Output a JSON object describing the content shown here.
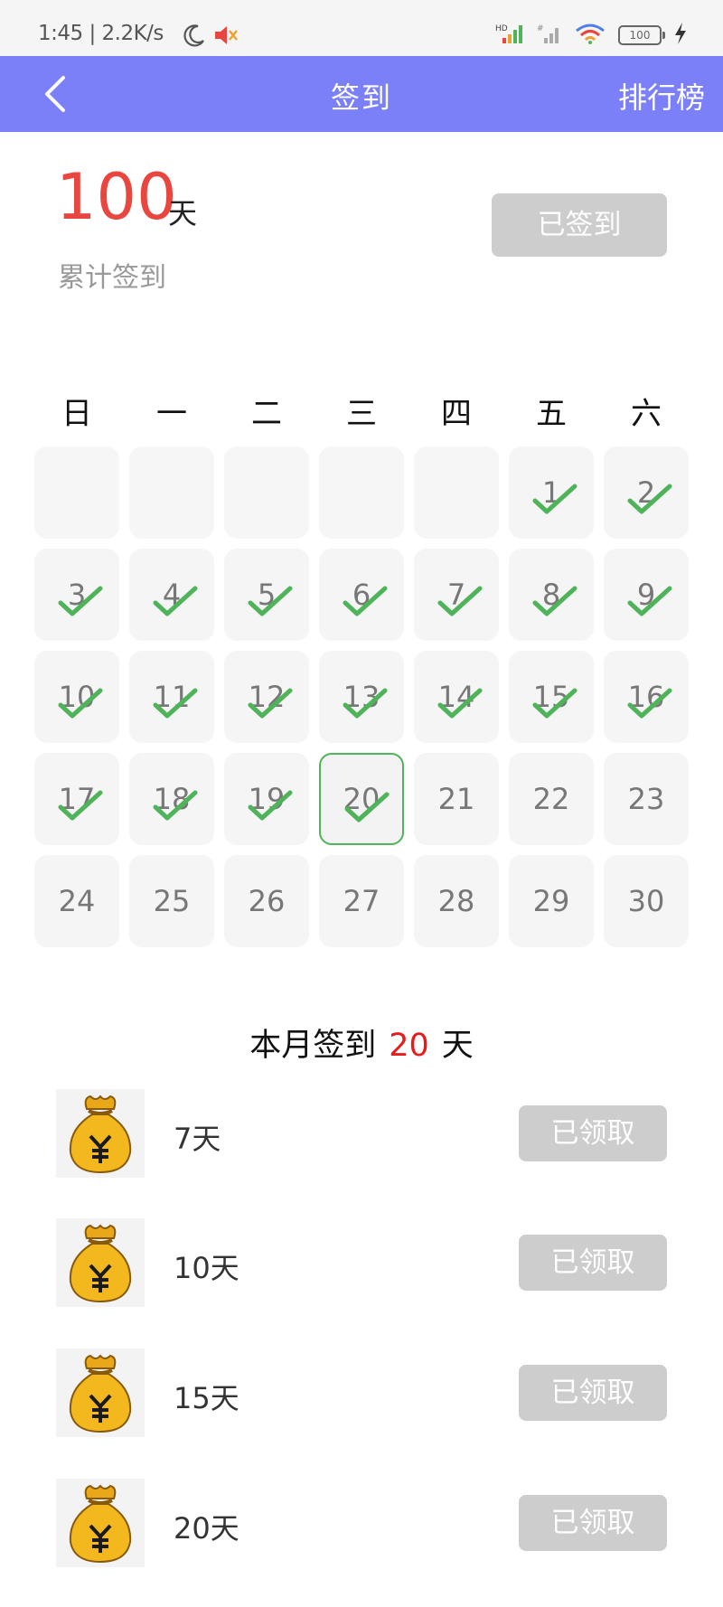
{
  "status_bar": {
    "time_speed": "1:45 | 2.2K/s",
    "battery": "100",
    "icons": [
      "moon-icon",
      "mute-icon",
      "hd-signal-icon",
      "signal-icon",
      "wifi-icon",
      "battery-icon",
      "charging-icon"
    ]
  },
  "nav": {
    "title": "签到",
    "ranking": "排行榜",
    "back_icon": "chevron-left-icon"
  },
  "summary": {
    "total_days": "100",
    "unit": "天",
    "label": "累计签到",
    "button": "已签到"
  },
  "calendar": {
    "weekdays": [
      "日",
      "一",
      "二",
      "三",
      "四",
      "五",
      "六"
    ],
    "leading_blanks": 5,
    "days_in_month": 30,
    "today": 20,
    "checked_days": [
      1,
      2,
      3,
      4,
      5,
      6,
      7,
      8,
      9,
      10,
      11,
      12,
      13,
      14,
      15,
      16,
      17,
      18,
      19,
      20
    ],
    "check_color": "#4fb35a"
  },
  "month": {
    "prefix": "本月签到",
    "count": "20",
    "unit": "天"
  },
  "rewards": [
    {
      "label": "7天",
      "button": "已领取",
      "icon": "money-bag-icon"
    },
    {
      "label": "10天",
      "button": "已领取",
      "icon": "money-bag-icon"
    },
    {
      "label": "15天",
      "button": "已领取",
      "icon": "money-bag-icon"
    },
    {
      "label": "20天",
      "button": "已领取",
      "icon": "money-bag-icon"
    }
  ],
  "colors": {
    "nav_bg": "#7b80f8",
    "accent_red": "#e8463f",
    "button_disabled": "#cdcdcd"
  }
}
